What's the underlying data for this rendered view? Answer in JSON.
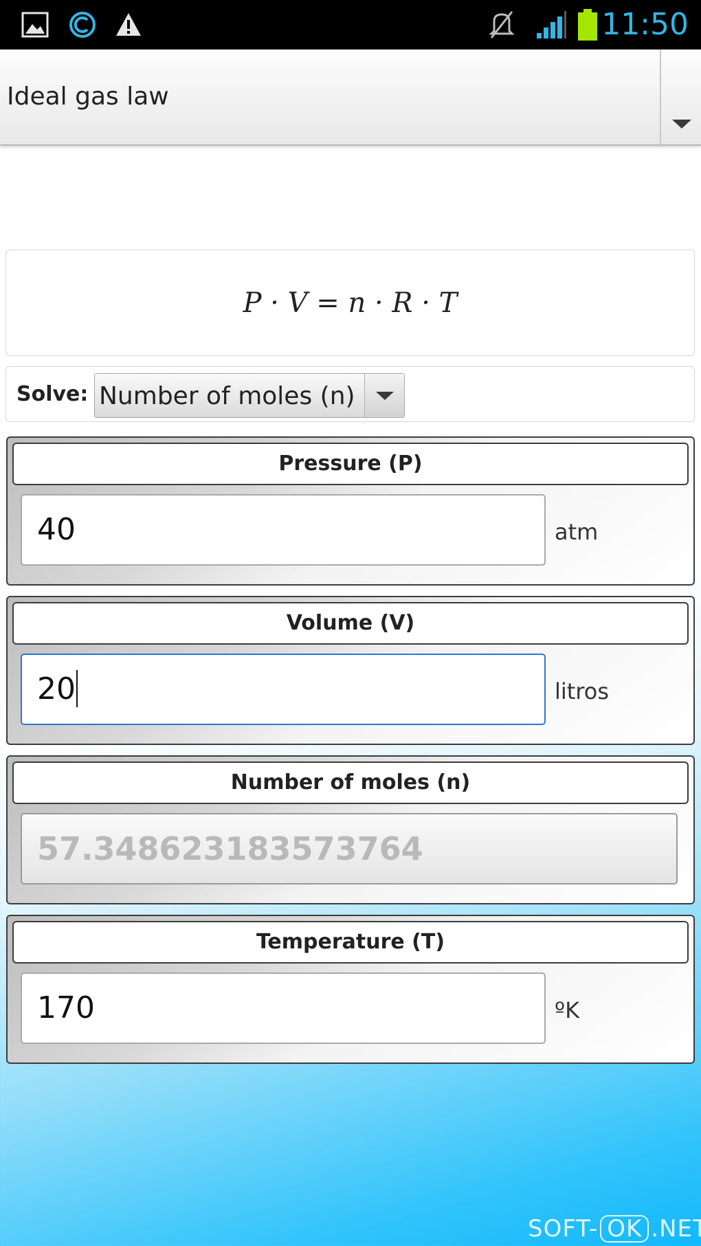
{
  "status_bar": {
    "time": "11:50",
    "icons": [
      "gallery-icon",
      "sync-icon",
      "warning-icon",
      "muted-icon",
      "signal-icon",
      "battery-icon"
    ],
    "accent_color": "#33b5e5",
    "battery_color": "#a4e600"
  },
  "title_spinner": {
    "value": "Ideal gas law"
  },
  "formula": {
    "text": "P · V = n · R · T"
  },
  "solve": {
    "label": "Solve:",
    "selected": "Number of moles (n)"
  },
  "variables": [
    {
      "title": "Pressure (P)",
      "value": "40",
      "unit": "atm"
    },
    {
      "title": "Volume (V)",
      "value": "20",
      "unit": "litros"
    },
    {
      "title": "Number of moles (n)",
      "value": "57.348623183573764",
      "unit": ""
    },
    {
      "title": "Temperature (T)",
      "value": "170",
      "unit": "ºK"
    }
  ],
  "watermark": {
    "prefix": "SOFT-",
    "middle": "OK",
    "suffix": ".NET"
  }
}
